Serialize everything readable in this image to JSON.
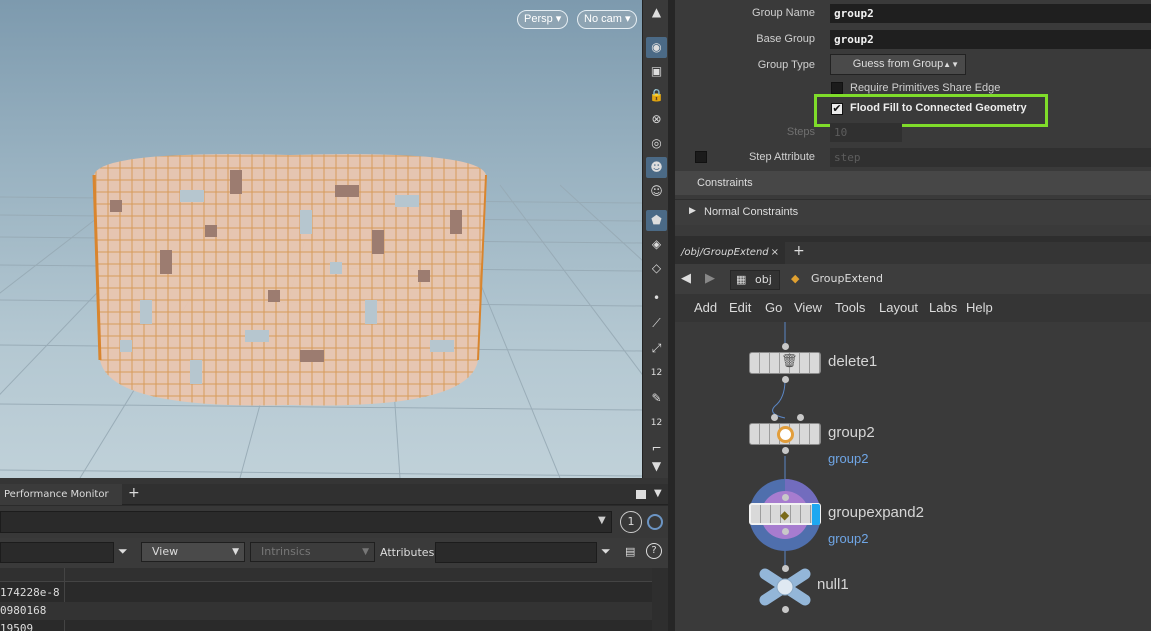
{
  "viewport": {
    "perspective_label": "Persp",
    "camera_label": "No cam",
    "tools": [
      "eye-icon",
      "view-icon",
      "lock-icon",
      "light-icon",
      "display-icon",
      "ghost-icon",
      "skeleton-icon",
      "wire-icon",
      "camera-icon",
      "snap-icon",
      "point-icon",
      "vertex-icon",
      "prim-icon",
      "number-icon",
      "brush-icon",
      "number2-icon",
      "curve-icon",
      "down-icon"
    ]
  },
  "bottom_panel": {
    "tab_label": "Performance Monitor",
    "add_tab": "+",
    "page_number": "1",
    "view_label": "View",
    "intrinsics_label": "Intrinsics",
    "attributes_label": "Attributes:",
    "rows": [
      "174228e-8",
      "0980168",
      "19509"
    ]
  },
  "params": {
    "group_name_label": "Group Name",
    "group_name_value": "group2",
    "base_group_label": "Base Group",
    "base_group_value": "group2",
    "group_type_label": "Group Type",
    "group_type_value": "Guess from Group",
    "require_prims_label": "Require Primitives Share Edge",
    "flood_fill_label": "Flood Fill to Connected Geometry",
    "steps_label": "Steps",
    "steps_value": "10",
    "step_attr_label": "Step Attribute",
    "step_attr_value": "step",
    "constraints_label": "Constraints",
    "normal_constraints_label": "Normal Constraints",
    "highlight_color": "#7fdc2a"
  },
  "network": {
    "tab_label": "/obj/GroupExtend",
    "tab_close": "×",
    "add_tab": "+",
    "path_obj": "obj",
    "path_node": "GroupExtend",
    "menu": [
      "Add",
      "Edit",
      "Go",
      "View",
      "Tools",
      "Layout",
      "Labs",
      "Help"
    ],
    "nodes": [
      {
        "name": "delete1",
        "sub": ""
      },
      {
        "name": "group2",
        "sub": "group2"
      },
      {
        "name": "groupexpand2",
        "sub": "group2"
      },
      {
        "name": "null1",
        "sub": ""
      }
    ]
  }
}
